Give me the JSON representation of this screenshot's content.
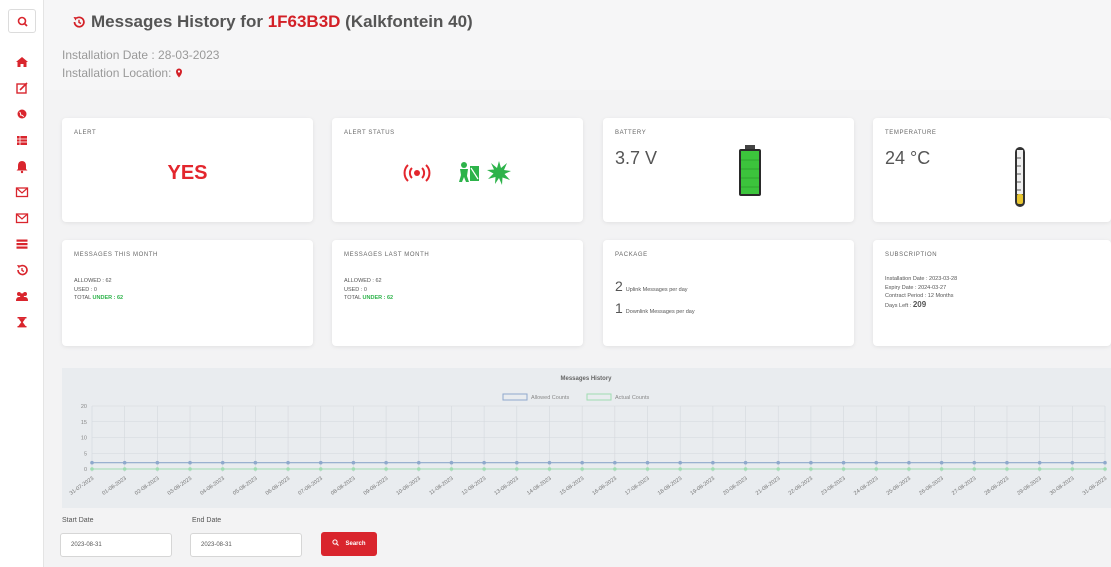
{
  "header": {
    "title_prefix": "Messages History for ",
    "serial": "1F63B3D",
    "title_suffix": " (Kalkfontein 40)",
    "installation_date": "Installation Date : 28-03-2023",
    "installation_location": "Installation Location:"
  },
  "sidebar": {
    "icons": [
      "search-icon",
      "home-icon",
      "edit-icon",
      "globe-icon",
      "list-box-icon",
      "bell-icon",
      "envelope-icon",
      "envelope-icon",
      "list-icon",
      "history-icon",
      "users-icon",
      "hourglass-icon"
    ]
  },
  "cards": {
    "alert": {
      "label": "ALERT",
      "value": "YES"
    },
    "alert_status": {
      "label": "ALERT STATUS",
      "icons": [
        "alarm-signal-icon",
        "intruder-icon",
        "burst-icon"
      ]
    },
    "battery": {
      "label": "BATTERY",
      "value": "3.7 V",
      "level": 1.0
    },
    "temperature": {
      "label": "TEMPERATURE",
      "value": "24 °C"
    },
    "messages_this_month": {
      "label": "MESSAGES THIS MONTH",
      "allowed": "ALLOWED : 62",
      "used": "USED : 0",
      "total_prefix": "TOTAL ",
      "total_value": "UNDER : 62"
    },
    "messages_last_month": {
      "label": "MESSAGES LAST MONTH",
      "allowed": "ALLOWED : 62",
      "used": "USED : 0",
      "total_prefix": "TOTAL ",
      "total_value": "UNDER : 62"
    },
    "package": {
      "label": "PACKAGE",
      "uplink_count": "2",
      "uplink_text": "Uplink Messages per day",
      "downlink_count": "1",
      "downlink_text": "Downlink Messages per day"
    },
    "subscription": {
      "label": "SUBSCRIPTION",
      "installation_date": "Installation Date : 2023-03-28",
      "expiry_date": "Expiry Date : 2024-03-27",
      "contract_period": "Contract Period : 12 Months",
      "days_left_label": "Days Left : ",
      "days_left_value": "209"
    }
  },
  "chart_data": {
    "type": "line",
    "title": "Messages History",
    "categories": [
      "31-07-2023",
      "01-08-2023",
      "02-08-2023",
      "03-08-2023",
      "04-08-2023",
      "05-08-2023",
      "06-08-2023",
      "07-08-2023",
      "08-08-2023",
      "09-08-2023",
      "10-08-2023",
      "11-08-2023",
      "12-08-2023",
      "13-08-2023",
      "14-08-2023",
      "15-08-2023",
      "16-08-2023",
      "17-08-2023",
      "18-08-2023",
      "19-08-2023",
      "20-08-2023",
      "21-08-2023",
      "22-08-2023",
      "23-08-2023",
      "24-08-2023",
      "25-08-2023",
      "26-08-2023",
      "27-08-2023",
      "28-08-2023",
      "29-08-2023",
      "30-08-2023",
      "31-08-2023"
    ],
    "series": [
      {
        "name": "Allowed Counts",
        "color": "#8fa9cc",
        "values": [
          2,
          2,
          2,
          2,
          2,
          2,
          2,
          2,
          2,
          2,
          2,
          2,
          2,
          2,
          2,
          2,
          2,
          2,
          2,
          2,
          2,
          2,
          2,
          2,
          2,
          2,
          2,
          2,
          2,
          2,
          2,
          2
        ]
      },
      {
        "name": "Actual Counts",
        "color": "#9fdcb2",
        "values": [
          0,
          0,
          0,
          0,
          0,
          0,
          0,
          0,
          0,
          0,
          0,
          0,
          0,
          0,
          0,
          0,
          0,
          0,
          0,
          0,
          0,
          0,
          0,
          0,
          0,
          0,
          0,
          0,
          0,
          0,
          0,
          0
        ]
      }
    ],
    "yticks": [
      "20",
      "15",
      "10",
      "5",
      "0"
    ],
    "ylim": [
      0,
      20
    ],
    "grid": true,
    "legend": "top-center"
  },
  "filter": {
    "start_label": "Start Date",
    "start_value": "2023-08-31",
    "end_label": "End Date",
    "end_value": "2023-08-31",
    "search_label": "Search"
  },
  "colors": {
    "accent": "#d9252d",
    "green": "#2db34a"
  }
}
